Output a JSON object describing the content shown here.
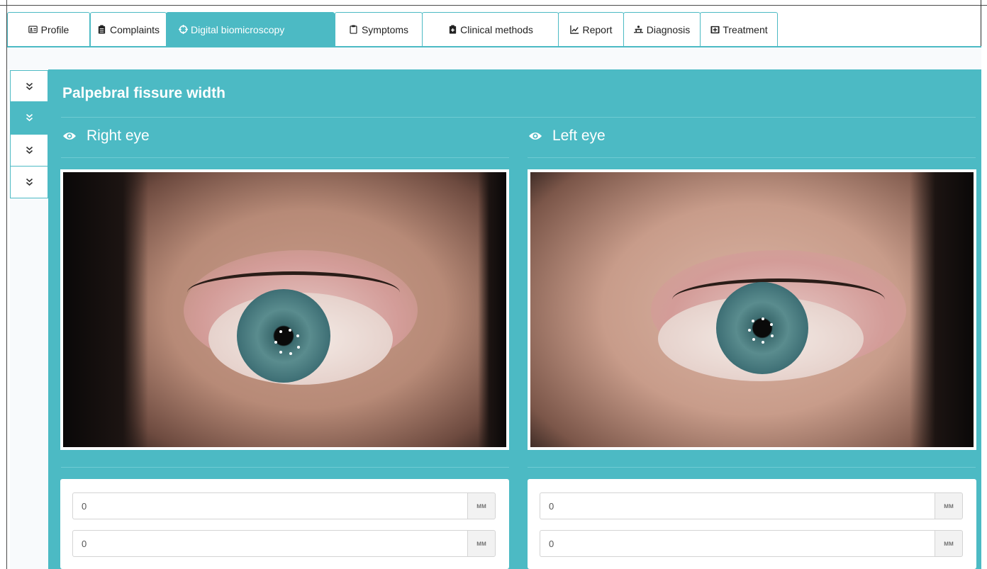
{
  "tabs": [
    {
      "label": "Profile",
      "icon": "id-card-icon"
    },
    {
      "label": "Complaints",
      "icon": "clipboard-list-icon"
    },
    {
      "label": "Digital biomicroscopy",
      "icon": "crosshairs-icon",
      "active": true
    },
    {
      "label": "Symptoms",
      "icon": "clipboard-icon"
    },
    {
      "label": "Clinical methods",
      "icon": "medical-clipboard-icon"
    },
    {
      "label": "Report",
      "icon": "chart-line-icon"
    },
    {
      "label": "Diagnosis",
      "icon": "diagnosis-icon"
    },
    {
      "label": "Treatment",
      "icon": "medkit-icon"
    }
  ],
  "side_buttons": [
    {
      "icon": "chevron-double-down-icon",
      "active": false
    },
    {
      "icon": "chevron-double-down-icon",
      "active": true
    },
    {
      "icon": "chevron-double-down-icon",
      "active": false
    },
    {
      "icon": "chevron-double-down-icon",
      "active": false
    }
  ],
  "panel": {
    "title": "Palpebral fissure width",
    "right_eye": {
      "label": "Right eye",
      "inputs": [
        {
          "value": "0",
          "unit": "мм"
        },
        {
          "value": "0",
          "unit": "мм"
        }
      ]
    },
    "left_eye": {
      "label": "Left eye",
      "inputs": [
        {
          "value": "0",
          "unit": "мм"
        },
        {
          "value": "0",
          "unit": "мм"
        }
      ]
    }
  },
  "colors": {
    "accent": "#4cbac4",
    "panel_divider": "#6fcbd3",
    "background": "#f8fafc"
  }
}
